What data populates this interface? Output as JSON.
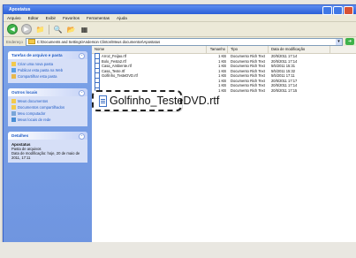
{
  "window": {
    "title": "Apostatus"
  },
  "menu": [
    "Arquivo",
    "Editar",
    "Exibir",
    "Favoritos",
    "Ferramentas",
    "Ajuda"
  ],
  "toolbar": {
    "back_icon": "back-arrow-icon",
    "forward_icon": "forward-arrow-icon"
  },
  "address": {
    "label": "Endereço",
    "path": "C:\\Documents and Settings\\Anderson Clinton\\Meus documentos\\Apostatus"
  },
  "left_pane": {
    "tasks": {
      "title": "Tarefas de arquivo e pasta",
      "items": [
        "Criar uma nova pasta",
        "Publicar esta pasta na Web",
        "Compartilhar esta pasta"
      ]
    },
    "places": {
      "title": "Outros locais",
      "items": [
        "Meus documentos",
        "Documentos compartilhados",
        "Meu computador",
        "Meus locais de rede"
      ]
    },
    "details": {
      "title": "Detalhes",
      "name": "Apostatus",
      "kind": "Pasta de arquivos",
      "modified": "Data de modificação: hoje, 20 de maio de 2011, 17:11"
    }
  },
  "file_list": {
    "headers": {
      "name": "Nome",
      "size": "Tamanho",
      "type": "Tipo",
      "date": "Data de modificação"
    },
    "rows": [
      {
        "name": "Arroz_Feijao.rtf",
        "size": "1 KB",
        "type": "Documento Rich Text",
        "date": "20/5/2011 17:14"
      },
      {
        "name": "Bolo_Festa2.rtf",
        "size": "1 KB",
        "type": "Documento Rich Text",
        "date": "20/5/2011 17:14"
      },
      {
        "name": "Casa_Ambiente.rtf",
        "size": "1 KB",
        "type": "Documento Rich Text",
        "date": "5/5/2011 15:31"
      },
      {
        "name": "Casa_Teste.rtf",
        "size": "1 KB",
        "type": "Documento Rich Text",
        "date": "5/5/2011 15:32"
      },
      {
        "name": "Golfinho_TesteDVD.rtf",
        "size": "1 KB",
        "type": "Documento Rich Text",
        "date": "5/5/2011 17:11"
      },
      {
        "name": "",
        "size": "1 KB",
        "type": "Documento Rich Text",
        "date": "20/5/2011 17:17"
      },
      {
        "name": "",
        "size": "1 KB",
        "type": "Documento Rich Text",
        "date": "20/5/2011 17:14"
      },
      {
        "name": "",
        "size": "1 KB",
        "type": "Documento Rich Text",
        "date": "20/5/2011 17:15"
      }
    ]
  },
  "callout": {
    "label": "Golfinho_TesteDVD.rtf"
  }
}
